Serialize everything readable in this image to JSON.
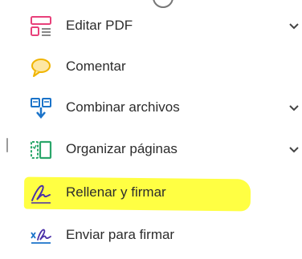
{
  "tools_panel": {
    "items": [
      {
        "label": "Editar PDF",
        "icon": "edit-pdf-icon",
        "has_chevron": true
      },
      {
        "label": "Comentar",
        "icon": "comment-icon",
        "has_chevron": false
      },
      {
        "label": "Combinar archivos",
        "icon": "combine-files-icon",
        "has_chevron": true
      },
      {
        "label": "Organizar páginas",
        "icon": "organize-pages-icon",
        "has_chevron": true
      },
      {
        "label": "Rellenar y firmar",
        "icon": "fill-sign-icon",
        "has_chevron": false,
        "highlighted": true
      },
      {
        "label": "Enviar para firmar",
        "icon": "send-for-signature-icon",
        "has_chevron": false
      }
    ]
  },
  "colors": {
    "highlight": "#ffff33",
    "edit_icon": "#e8407a",
    "comment_icon": "#f0b400",
    "combine_icon": "#1a73c9",
    "organize_icon": "#2aa66a",
    "sign_icon": "#4a2fa8",
    "text": "#2c2c2c"
  }
}
